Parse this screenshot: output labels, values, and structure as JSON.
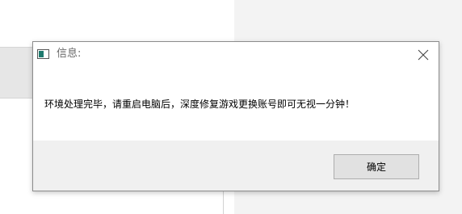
{
  "dialog": {
    "title": "信息:",
    "message": "环境处理完毕，请重启电脑后，深度修复游戏更换账号即可无视一分钟！",
    "ok_label": "确定",
    "icons": {
      "app": "app-window-icon",
      "close": "close-icon"
    }
  },
  "colors": {
    "dialog_bg": "#f0f0f0",
    "content_bg": "#ffffff",
    "button_bg": "#e1e1e1",
    "button_border": "#adadad",
    "icon_accent": "#1f7a6e"
  }
}
